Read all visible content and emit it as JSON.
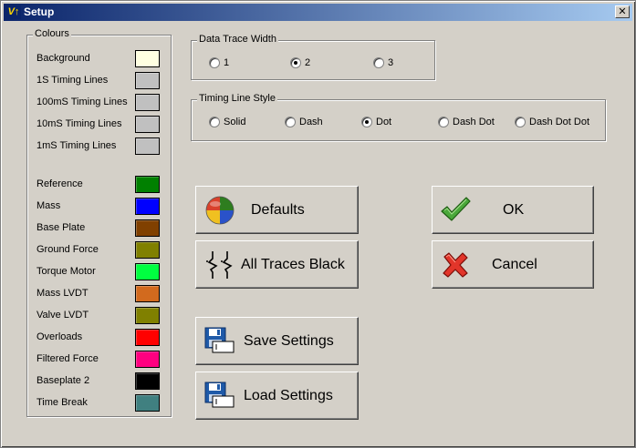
{
  "window": {
    "title": "Setup",
    "app_icon": "V↑",
    "close_glyph": "✕"
  },
  "colours": {
    "legend": "Colours",
    "items": [
      {
        "label": "Background",
        "color": "#ffffe1"
      },
      {
        "label": "1S Timing Lines",
        "color": "#c0c0c0"
      },
      {
        "label": "100mS Timing Lines",
        "color": "#c0c0c0"
      },
      {
        "label": "10mS Timing Lines",
        "color": "#c0c0c0"
      },
      {
        "label": "1mS Timing Lines",
        "color": "#c0c0c0"
      },
      {
        "label": "Reference",
        "color": "#008000"
      },
      {
        "label": "Mass",
        "color": "#0000ff"
      },
      {
        "label": "Base Plate",
        "color": "#804000"
      },
      {
        "label": "Ground Force",
        "color": "#808000"
      },
      {
        "label": "Torque Motor",
        "color": "#00ff40"
      },
      {
        "label": "Mass LVDT",
        "color": "#d26a1e"
      },
      {
        "label": "Valve LVDT",
        "color": "#808000"
      },
      {
        "label": "Overloads",
        "color": "#ff0000"
      },
      {
        "label": "Filtered Force",
        "color": "#ff0080"
      },
      {
        "label": "Baseplate 2",
        "color": "#000000"
      },
      {
        "label": "Time Break",
        "color": "#408080"
      }
    ]
  },
  "trace_width": {
    "legend": "Data Trace Width",
    "options": [
      {
        "label": "1",
        "checked": false
      },
      {
        "label": "2",
        "checked": true
      },
      {
        "label": "3",
        "checked": false
      }
    ]
  },
  "timing_style": {
    "legend": "Timing Line Style",
    "options": [
      {
        "label": "Solid",
        "checked": false
      },
      {
        "label": "Dash",
        "checked": false
      },
      {
        "label": "Dot",
        "checked": true
      },
      {
        "label": "Dash Dot",
        "checked": false
      },
      {
        "label": "Dash Dot Dot",
        "checked": false
      }
    ]
  },
  "buttons": {
    "defaults": "Defaults",
    "all_black": "All Traces Black",
    "save": "Save Settings",
    "load": "Load Settings",
    "ok": "OK",
    "cancel": "Cancel"
  },
  "icons": {
    "defaults": "color-wheel-icon",
    "all_black": "black-traces-icon",
    "save": "floppy-disk-save-icon",
    "load": "floppy-disk-load-icon",
    "ok": "check-mark-icon",
    "cancel": "red-x-icon"
  }
}
